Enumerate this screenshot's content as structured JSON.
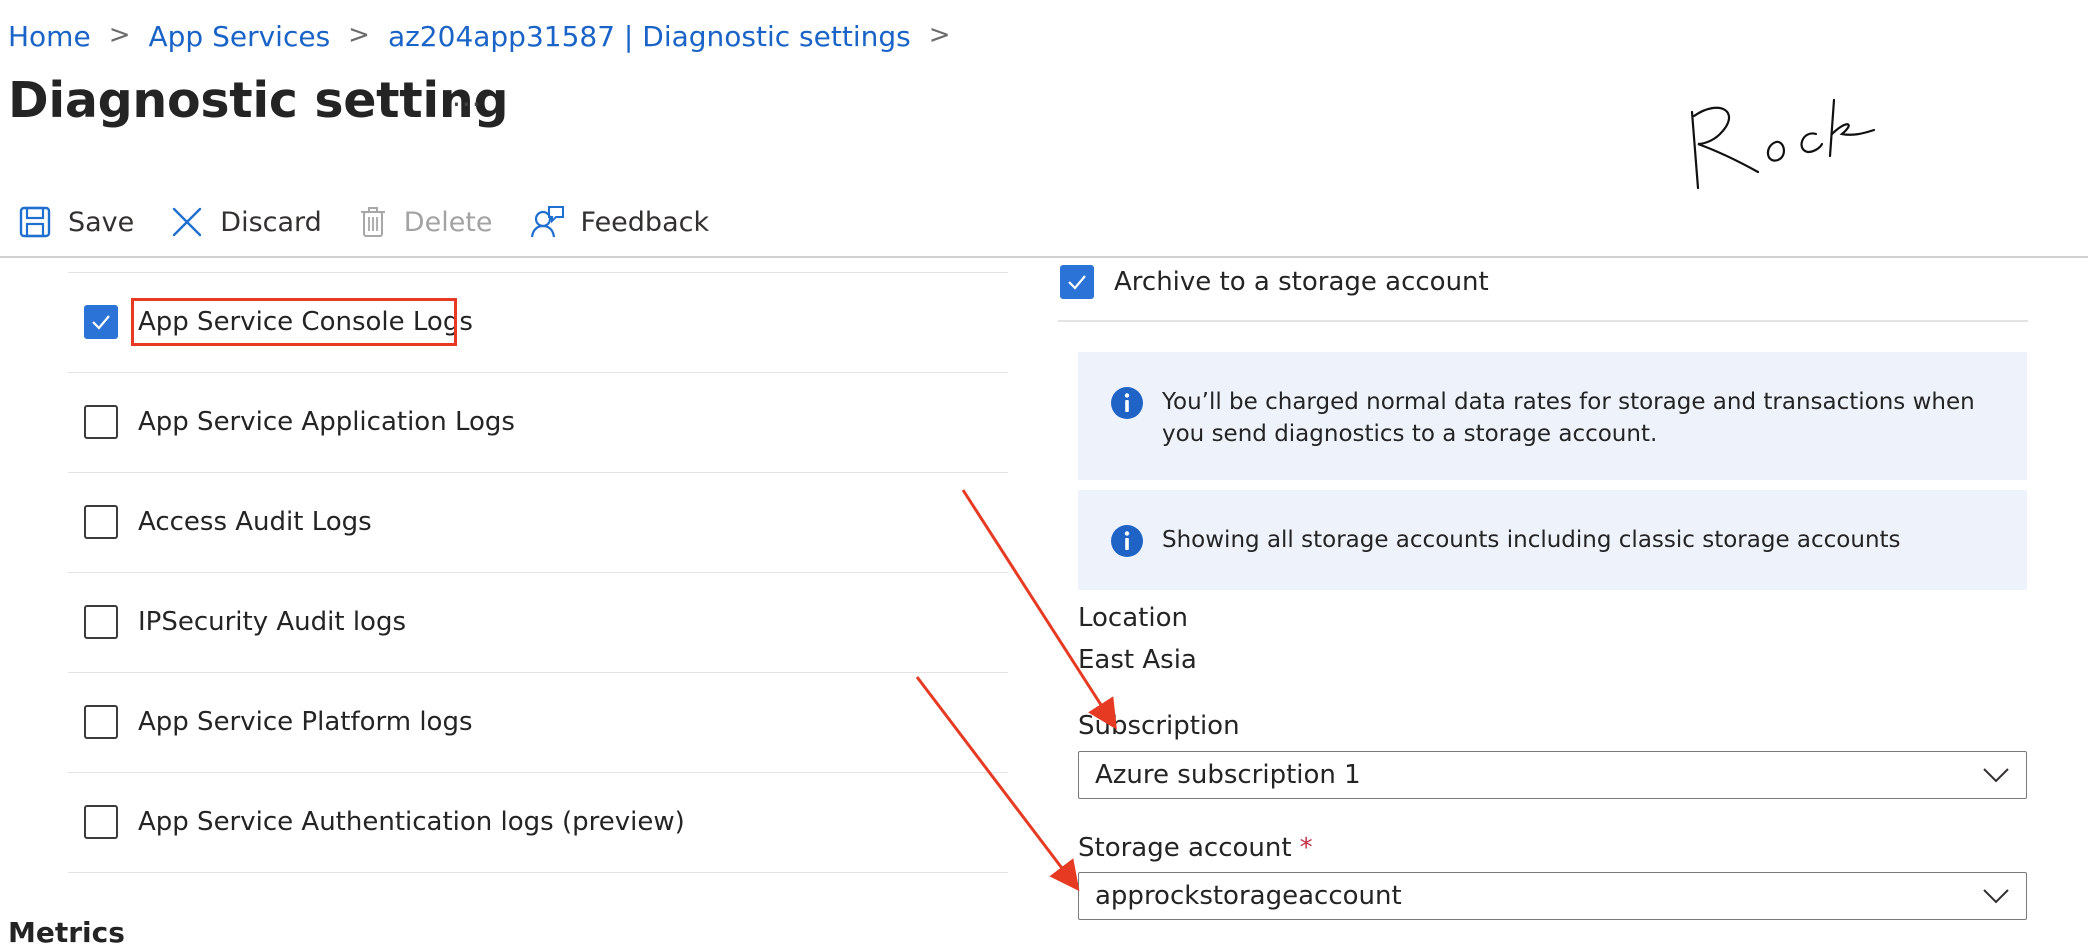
{
  "breadcrumb": {
    "items": [
      "Home",
      "App Services",
      "az204app31587 | Diagnostic settings"
    ],
    "separator": ">"
  },
  "page": {
    "title": "Diagnostic setting",
    "more_label": "···"
  },
  "toolbar": {
    "save_label": "Save",
    "discard_label": "Discard",
    "delete_label": "Delete",
    "feedback_label": "Feedback"
  },
  "log_categories": [
    {
      "label": "App Service Console Logs",
      "checked": true
    },
    {
      "label": "App Service Application Logs",
      "checked": false
    },
    {
      "label": "Access Audit Logs",
      "checked": false
    },
    {
      "label": "IPSecurity Audit logs",
      "checked": false
    },
    {
      "label": "App Service Platform logs",
      "checked": false
    },
    {
      "label": "App Service Authentication logs (preview)",
      "checked": false
    }
  ],
  "metrics": {
    "title": "Metrics"
  },
  "destination": {
    "archive_label": "Archive to a storage account",
    "archive_checked": true,
    "info_charges": "You’ll be charged normal data rates for storage and transactions when you send diagnostics to a storage account.",
    "info_classic": "Showing all storage accounts including classic storage accounts",
    "location_label": "Location",
    "location_value": "East Asia",
    "subscription_label": "Subscription",
    "subscription_value": "Azure subscription 1",
    "storage_label": "Storage account",
    "storage_required": "*",
    "storage_value": "approckstorageaccount"
  },
  "annotation": {
    "handwriting": "Rock"
  },
  "colors": {
    "accent": "#2b73d6",
    "link": "#1a64c8",
    "highlight": "#e63a23",
    "info_bg": "#eef3fb"
  }
}
